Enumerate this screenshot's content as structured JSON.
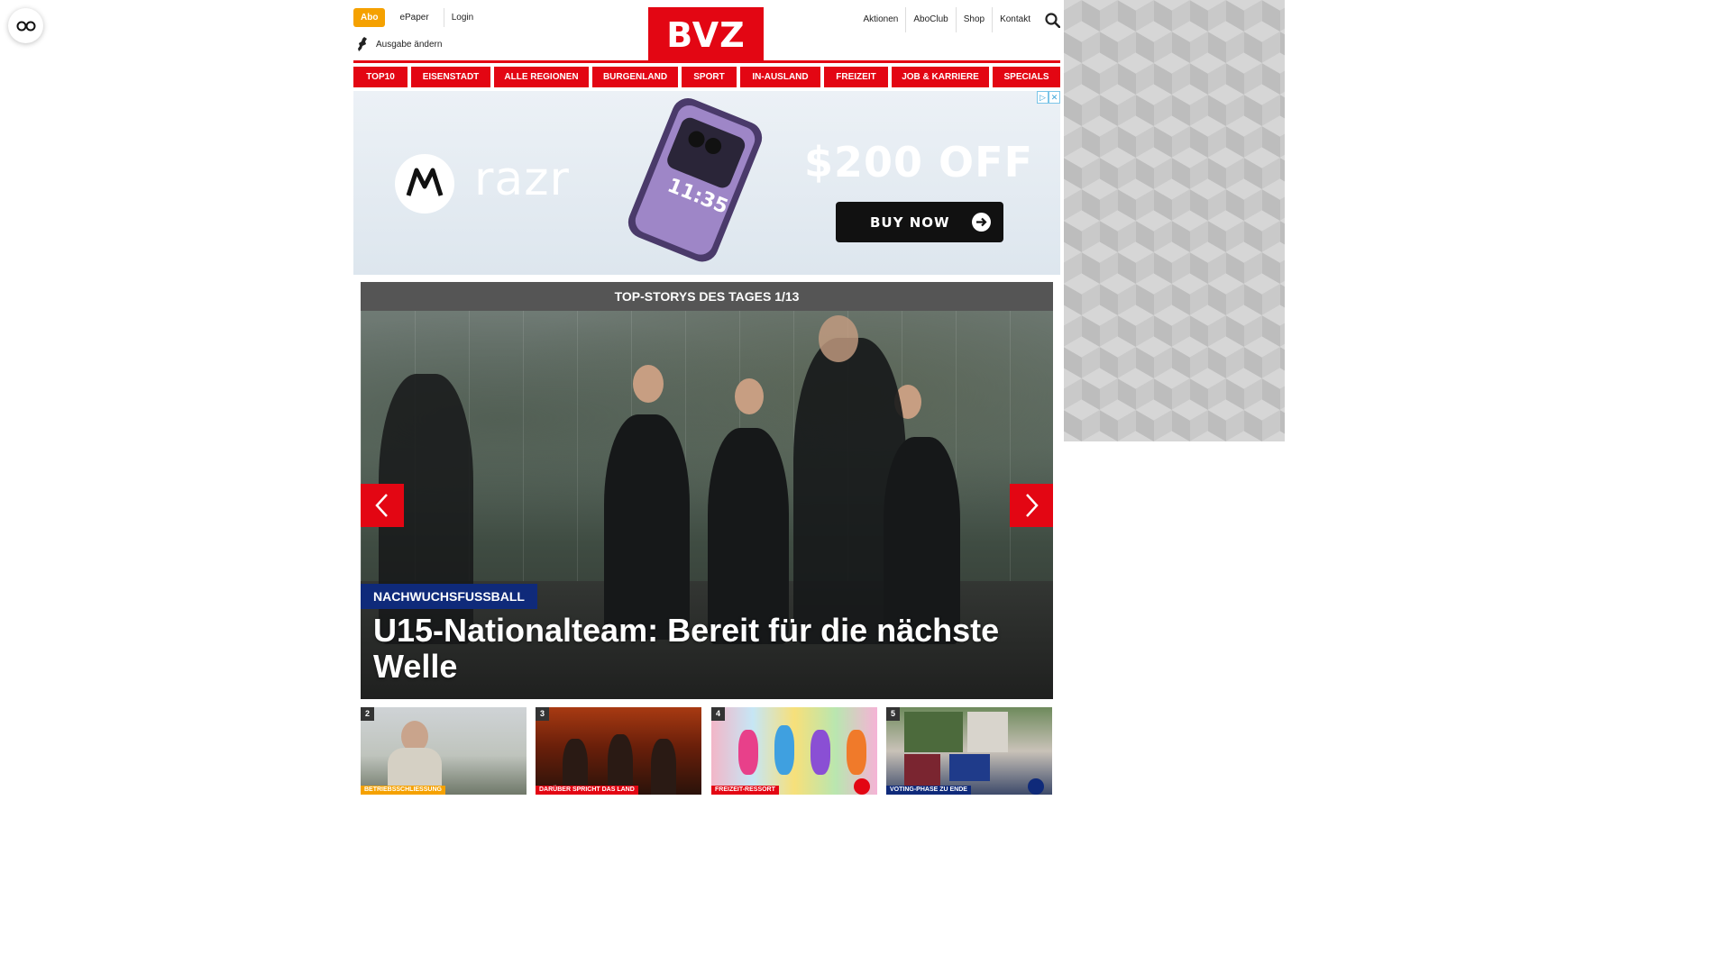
{
  "header": {
    "abo_label": "Abo",
    "util_left": [
      "ePaper",
      "Login"
    ],
    "ausgabe_label": "Ausgabe ändern",
    "logo_text": "BVZ",
    "util_right": [
      "Aktionen",
      "AboClub",
      "Shop",
      "Kontakt"
    ],
    "search_icon": "search-icon"
  },
  "nav": {
    "items": [
      "TOP10",
      "EISENSTADT",
      "ALLE REGIONEN",
      "BURGENLAND",
      "SPORT",
      "IN-AUSLAND",
      "FREIZEIT",
      "JOB & KARRIERE",
      "SPECIALS"
    ]
  },
  "ad": {
    "brand": "razr",
    "offer": "$200 OFF",
    "cta": "BUY NOW",
    "phone_time": "11:35"
  },
  "stories": {
    "heading": "TOP-STORYS DES TAGES 1/13",
    "hero": {
      "kicker": "NACHWUCHSFUSSBALL",
      "title": "U15-Nationalteam: Bereit für die nächste Welle"
    },
    "thumbs": [
      {
        "num": "2",
        "tag": "BETRIEBSSCHLIESSUNG",
        "tag_color": "#f5a100"
      },
      {
        "num": "3",
        "tag": "DARÜBER SPRICHT DAS LAND",
        "tag_color": "#e30613"
      },
      {
        "num": "4",
        "tag": "FREIZEIT-RESSORT",
        "tag_color": "#e30613"
      },
      {
        "num": "5",
        "tag": "VOTING-PHASE ZU ENDE",
        "tag_color": "#0f2a7a"
      }
    ]
  },
  "colors": {
    "brand_red": "#e30613",
    "abo_orange": "#f5a100",
    "kicker_blue": "#0f2a7a",
    "header_gray": "#555555"
  }
}
